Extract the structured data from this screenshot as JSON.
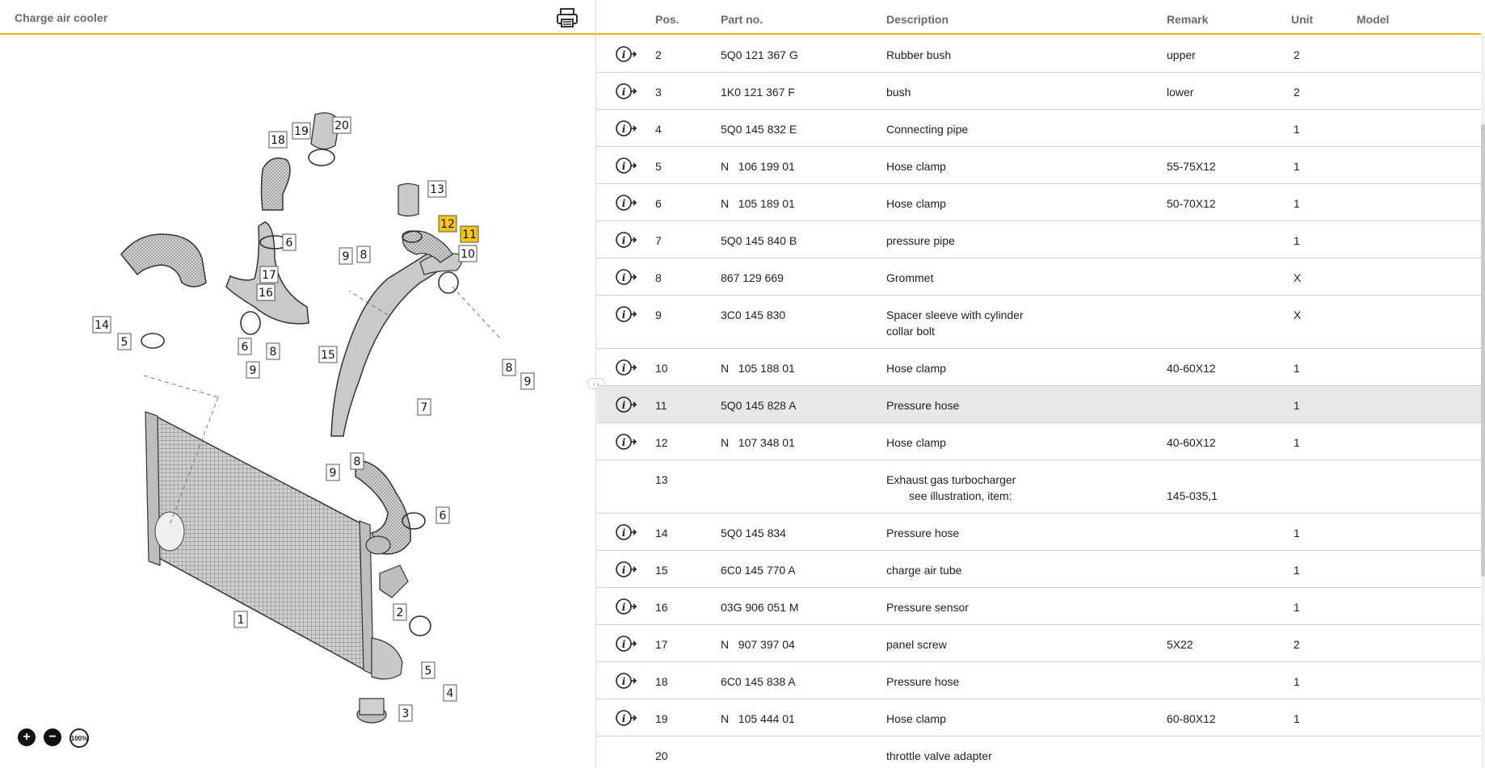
{
  "left": {
    "title": "Charge air cooler",
    "zoom_in": "+",
    "zoom_out": "−",
    "zoom_reset": "100%",
    "callouts": [
      "20",
      "19",
      "18",
      "13",
      "12",
      "11",
      "6",
      "10",
      "9",
      "8",
      "17",
      "16",
      "14",
      "5",
      "6",
      "8",
      "9",
      "15",
      "8",
      "9",
      "7",
      "9",
      "8",
      "6",
      "1",
      "2",
      "5",
      "4",
      "3"
    ],
    "highlighted": [
      "12",
      "11"
    ],
    "highlight_color": "#f5c518"
  },
  "columns": {
    "pos": "Pos.",
    "part_no": "Part no.",
    "description": "Description",
    "remark": "Remark",
    "unit": "Unit",
    "model": "Model"
  },
  "rows": [
    {
      "pos": "2",
      "part": "5Q0 121 367 G",
      "desc": "Rubber bush",
      "desc2": "",
      "remark": "upper",
      "unit": "2"
    },
    {
      "pos": "3",
      "part": "1K0 121 367 F",
      "desc": "bush",
      "desc2": "",
      "remark": "lower",
      "unit": "2"
    },
    {
      "pos": "4",
      "part": "5Q0 145 832 E",
      "desc": "Connecting pipe",
      "desc2": "",
      "remark": "",
      "unit": "1"
    },
    {
      "pos": "5",
      "part": "N   106 199 01",
      "desc": "Hose clamp",
      "desc2": "",
      "remark": "55-75X12",
      "unit": "1"
    },
    {
      "pos": "6",
      "part": "N   105 189 01",
      "desc": "Hose clamp",
      "desc2": "",
      "remark": "50-70X12",
      "unit": "1"
    },
    {
      "pos": "7",
      "part": "5Q0 145 840 B",
      "desc": "pressure pipe",
      "desc2": "",
      "remark": "",
      "unit": "1"
    },
    {
      "pos": "8",
      "part": "867 129 669",
      "desc": "Grommet",
      "desc2": "",
      "remark": "",
      "unit": "X"
    },
    {
      "pos": "9",
      "part": "3C0 145 830",
      "desc": "Spacer sleeve with cylinder",
      "desc2": "collar bolt",
      "remark": "",
      "unit": "X"
    },
    {
      "pos": "10",
      "part": "N   105 188 01",
      "desc": "Hose clamp",
      "desc2": "",
      "remark": "40-60X12",
      "unit": "1"
    },
    {
      "pos": "11",
      "part": "5Q0 145 828 A",
      "desc": "Pressure hose",
      "desc2": "",
      "remark": "",
      "unit": "1"
    },
    {
      "pos": "12",
      "part": "N   107 348 01",
      "desc": "Hose clamp",
      "desc2": "",
      "remark": "40-60X12",
      "unit": "1"
    },
    {
      "pos": "13",
      "part": "",
      "desc": "Exhaust gas turbocharger",
      "desc2": "see illustration, item:",
      "remark": "145-035,1",
      "unit": ""
    },
    {
      "pos": "14",
      "part": "5Q0 145 834",
      "desc": "Pressure hose",
      "desc2": "",
      "remark": "",
      "unit": "1"
    },
    {
      "pos": "15",
      "part": "6C0 145 770 A",
      "desc": "charge air tube",
      "desc2": "",
      "remark": "",
      "unit": "1"
    },
    {
      "pos": "16",
      "part": "03G 906 051 M",
      "desc": "Pressure sensor",
      "desc2": "",
      "remark": "",
      "unit": "1"
    },
    {
      "pos": "17",
      "part": "N   907 397 04",
      "desc": "panel screw",
      "desc2": "",
      "remark": "5X22",
      "unit": "2"
    },
    {
      "pos": "18",
      "part": "6C0 145 838 A",
      "desc": "Pressure hose",
      "desc2": "",
      "remark": "",
      "unit": "1"
    },
    {
      "pos": "19",
      "part": "N   105 444 01",
      "desc": "Hose clamp",
      "desc2": "",
      "remark": "60-80X12",
      "unit": "1"
    },
    {
      "pos": "20",
      "part": "",
      "desc": "throttle valve adapter",
      "desc2": "",
      "remark": "",
      "unit": ""
    }
  ],
  "selected_pos": "11",
  "accent_color": "#f0b400"
}
